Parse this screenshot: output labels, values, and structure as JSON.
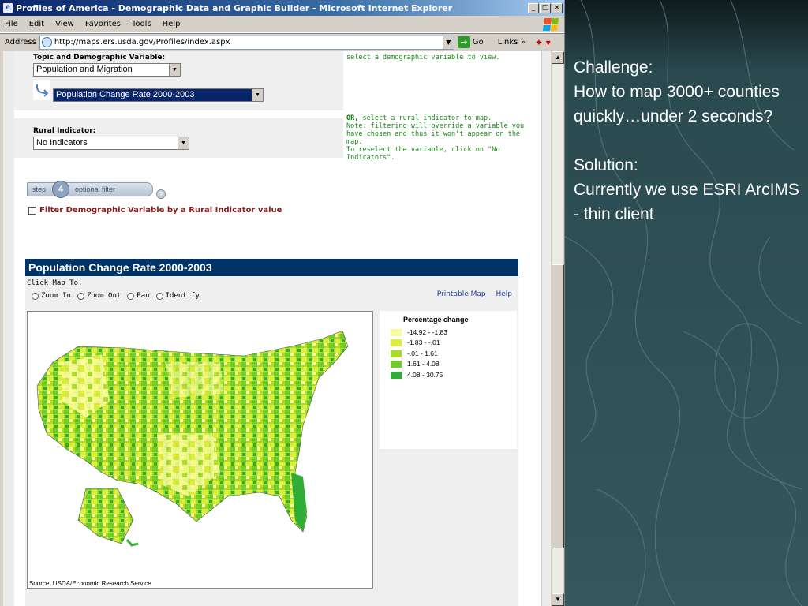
{
  "window": {
    "title": "Profiles of America - Demographic Data and Graphic Builder - Microsoft Internet Explorer",
    "buttons": [
      "_",
      "□",
      "×"
    ]
  },
  "menu": [
    "File",
    "Edit",
    "View",
    "Favorites",
    "Tools",
    "Help"
  ],
  "address": {
    "label": "Address",
    "url": "http://maps.ers.usda.gov/Profiles/index.aspx",
    "go": "Go",
    "links": "Links"
  },
  "form": {
    "topic_label": "Topic and Demographic Variable:",
    "topic_value": "Population and Migration",
    "variable_value": "Population Change Rate 2000-2003",
    "topic_note": "select a demographic variable to view.",
    "rural_label": "Rural Indicator:",
    "rural_value": "No Indicators",
    "rural_note_or": "OR,",
    "rural_note_1": " select a rural indicator to map.",
    "rural_note_2": "Note: filtering will override a variable you",
    "rural_note_3": "have chosen and thus it won't appear on the",
    "rural_note_4": "map.",
    "rural_note_5": "To reselect the variable, click on \"No",
    "rural_note_6": "Indicators\".",
    "step_label": "step",
    "step_number": "4",
    "step_name": "optional filter",
    "help_q": "?",
    "filter_label": "Filter Demographic Variable by a Rural Indicator value"
  },
  "map": {
    "title": "Population Change Rate 2000-2003",
    "click_to": "Click Map To:",
    "tools": [
      "Zoom In",
      "Zoom Out",
      "Pan",
      "Identify"
    ],
    "printable": "Printable Map",
    "help": "Help",
    "source": "Source: USDA/Economic Research Service",
    "legend_title": "Percentage change",
    "legend": [
      {
        "label": "-14.92 - -1.83",
        "color": "#fbfb9c"
      },
      {
        "label": "-1.83 - -.01",
        "color": "#ddee3a"
      },
      {
        "label": "-.01 - 1.61",
        "color": "#a8dc28"
      },
      {
        "label": "1.61 - 4.08",
        "color": "#70cc2a"
      },
      {
        "label": "4.08 - 30.75",
        "color": "#2fad36"
      }
    ]
  },
  "slide": {
    "line1": "Challenge:",
    "line2": "How to map 3000+ counties quickly…under 2 seconds?",
    "line3": "Solution:",
    "line4": "Currently we use ESRI ArcIMS - thin client"
  }
}
